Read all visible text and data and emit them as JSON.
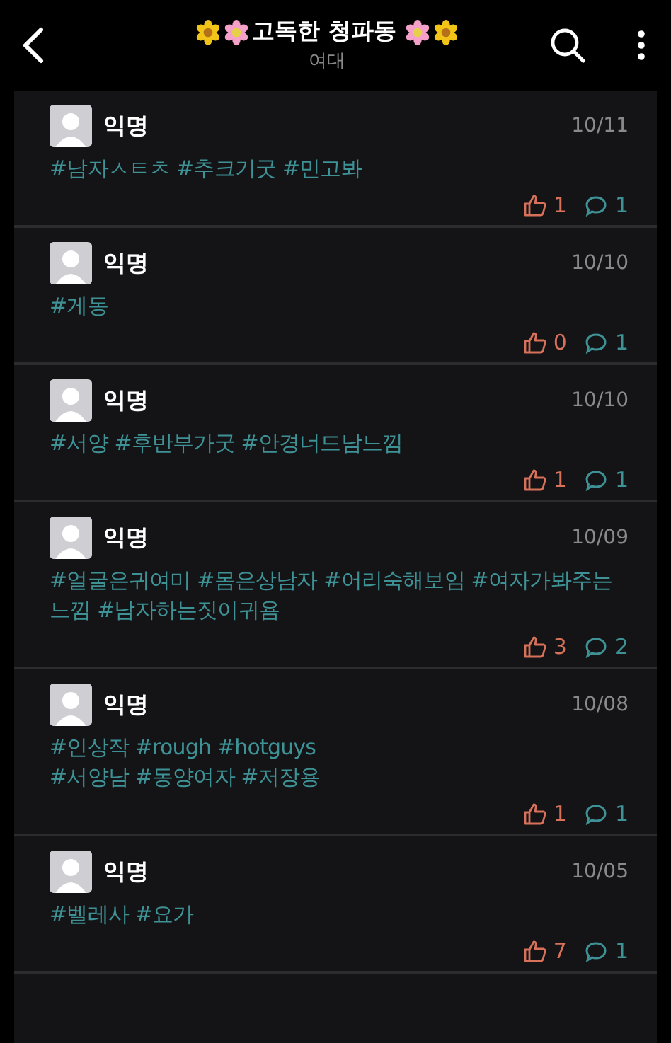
{
  "header": {
    "title": "고독한 청파동",
    "subtitle": "여대"
  },
  "posts": [
    {
      "author": "익명",
      "date": "10/11",
      "tag_lines": [
        "#남자ㅅㅌㅊ #추크기굿 #민고봐"
      ],
      "likes": "1",
      "comments": "1"
    },
    {
      "author": "익명",
      "date": "10/10",
      "tag_lines": [
        "#게동"
      ],
      "likes": "0",
      "comments": "1"
    },
    {
      "author": "익명",
      "date": "10/10",
      "tag_lines": [
        "#서양 #후반부가굿 #안경너드남느낌"
      ],
      "likes": "1",
      "comments": "1"
    },
    {
      "author": "익명",
      "date": "10/09",
      "tag_lines": [
        "#얼굴은귀여미 #몸은상남자 #어리숙해보임 #여자가봐주는느낌 #남자하는짓이귀욤"
      ],
      "likes": "3",
      "comments": "2"
    },
    {
      "author": "익명",
      "date": "10/08",
      "tag_lines": [
        "#인상작 #rough #hotguys",
        "#서양남 #동양여자 #저장용"
      ],
      "likes": "1",
      "comments": "1"
    },
    {
      "author": "익명",
      "date": "10/05",
      "tag_lines": [
        "#벨레사 #요가"
      ],
      "likes": "7",
      "comments": "1"
    }
  ]
}
